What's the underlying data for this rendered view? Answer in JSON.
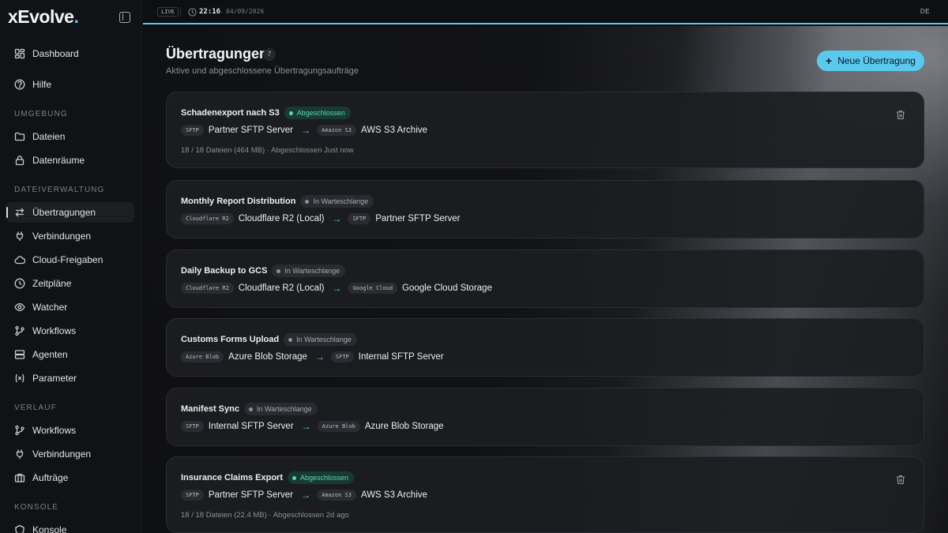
{
  "brand": {
    "name": "xEvolve",
    "dot": "."
  },
  "topbar": {
    "live": "LIVE",
    "time": "22:16",
    "separator": "·",
    "date": "04/09/2026",
    "language": "DE"
  },
  "sidebar": {
    "top_items": [
      {
        "label": "Dashboard",
        "icon": "dashboard-icon"
      },
      {
        "label": "Hilfe",
        "icon": "help-icon"
      }
    ],
    "sections": [
      {
        "label": "UMGEBUNG",
        "items": [
          {
            "label": "Dateien",
            "icon": "folder-icon"
          },
          {
            "label": "Datenräume",
            "icon": "lock-icon"
          }
        ]
      },
      {
        "label": "DATEIVERWALTUNG",
        "items": [
          {
            "label": "Übertragungen",
            "icon": "transfer-icon",
            "active": true
          },
          {
            "label": "Verbindungen",
            "icon": "plug-icon"
          },
          {
            "label": "Cloud-Freigaben",
            "icon": "cloud-icon"
          },
          {
            "label": "Zeitpläne",
            "icon": "clock-icon"
          },
          {
            "label": "Watcher",
            "icon": "eye-icon"
          },
          {
            "label": "Workflows",
            "icon": "workflow-icon"
          },
          {
            "label": "Agenten",
            "icon": "server-icon"
          },
          {
            "label": "Parameter",
            "icon": "variable-icon"
          }
        ]
      },
      {
        "label": "VERLAUF",
        "items": [
          {
            "label": "Workflows",
            "icon": "workflow-icon"
          },
          {
            "label": "Verbindungen",
            "icon": "plug-icon"
          },
          {
            "label": "Aufträge",
            "icon": "briefcase-icon"
          }
        ]
      },
      {
        "label": "KONSOLE",
        "items": [
          {
            "label": "Konsole",
            "icon": "shield-icon"
          }
        ]
      }
    ]
  },
  "page": {
    "title": "Übertragungen",
    "count": "7",
    "subtitle": "Aktive und abgeschlossene Übertragungsaufträge",
    "new_button": "Neue Übertragung"
  },
  "transfers": [
    {
      "name": "Schadenexport nach S3",
      "status": "Abgeschlossen",
      "status_kind": "done",
      "source_tag": "SFTP",
      "source": "Partner SFTP Server",
      "target_tag": "Amazon S3",
      "target": "AWS S3 Archive",
      "meta": "18 / 18 Dateien (464 MB) · Abgeschlossen Just now",
      "deletable": true
    },
    {
      "name": "Monthly Report Distribution",
      "status": "In Warteschlange",
      "status_kind": "queued",
      "source_tag": "Cloudflare R2",
      "source": "Cloudflare R2 (Local)",
      "target_tag": "SFTP",
      "target": "Partner SFTP Server",
      "meta": "",
      "deletable": false
    },
    {
      "name": "Daily Backup to GCS",
      "status": "In Warteschlange",
      "status_kind": "queued",
      "source_tag": "Cloudflare R2",
      "source": "Cloudflare R2 (Local)",
      "target_tag": "Google Cloud",
      "target": "Google Cloud Storage",
      "meta": "",
      "deletable": false
    },
    {
      "name": "Customs Forms Upload",
      "status": "In Warteschlange",
      "status_kind": "queued",
      "source_tag": "Azure Blob",
      "source": "Azure Blob Storage",
      "target_tag": "SFTP",
      "target": "Internal SFTP Server",
      "meta": "",
      "deletable": false
    },
    {
      "name": "Manifest Sync",
      "status": "In Warteschlange",
      "status_kind": "queued",
      "source_tag": "SFTP",
      "source": "Internal SFTP Server",
      "target_tag": "Azure Blob",
      "target": "Azure Blob Storage",
      "meta": "",
      "deletable": false
    },
    {
      "name": "Insurance Claims Export",
      "status": "Abgeschlossen",
      "status_kind": "done",
      "source_tag": "SFTP",
      "source": "Partner SFTP Server",
      "target_tag": "Amazon S3",
      "target": "AWS S3 Archive",
      "meta": "18 / 18 Dateien (22.4 MB) · Abgeschlossen 2d ago",
      "deletable": true
    }
  ],
  "colors": {
    "accent": "#5bc8ee",
    "done": "#5fd3b1",
    "queued": "#a6a9b0"
  }
}
